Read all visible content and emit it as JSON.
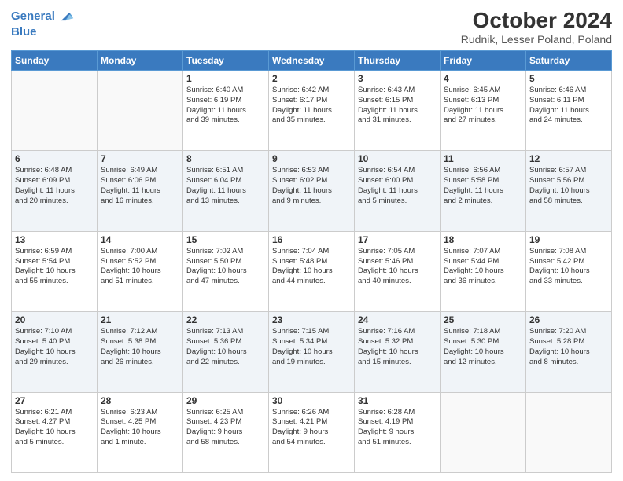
{
  "header": {
    "logo_line1": "General",
    "logo_line2": "Blue",
    "title": "October 2024",
    "subtitle": "Rudnik, Lesser Poland, Poland"
  },
  "weekdays": [
    "Sunday",
    "Monday",
    "Tuesday",
    "Wednesday",
    "Thursday",
    "Friday",
    "Saturday"
  ],
  "weeks": [
    {
      "alt": false,
      "days": [
        {
          "num": "",
          "lines": []
        },
        {
          "num": "",
          "lines": []
        },
        {
          "num": "1",
          "lines": [
            "Sunrise: 6:40 AM",
            "Sunset: 6:19 PM",
            "Daylight: 11 hours",
            "and 39 minutes."
          ]
        },
        {
          "num": "2",
          "lines": [
            "Sunrise: 6:42 AM",
            "Sunset: 6:17 PM",
            "Daylight: 11 hours",
            "and 35 minutes."
          ]
        },
        {
          "num": "3",
          "lines": [
            "Sunrise: 6:43 AM",
            "Sunset: 6:15 PM",
            "Daylight: 11 hours",
            "and 31 minutes."
          ]
        },
        {
          "num": "4",
          "lines": [
            "Sunrise: 6:45 AM",
            "Sunset: 6:13 PM",
            "Daylight: 11 hours",
            "and 27 minutes."
          ]
        },
        {
          "num": "5",
          "lines": [
            "Sunrise: 6:46 AM",
            "Sunset: 6:11 PM",
            "Daylight: 11 hours",
            "and 24 minutes."
          ]
        }
      ]
    },
    {
      "alt": true,
      "days": [
        {
          "num": "6",
          "lines": [
            "Sunrise: 6:48 AM",
            "Sunset: 6:09 PM",
            "Daylight: 11 hours",
            "and 20 minutes."
          ]
        },
        {
          "num": "7",
          "lines": [
            "Sunrise: 6:49 AM",
            "Sunset: 6:06 PM",
            "Daylight: 11 hours",
            "and 16 minutes."
          ]
        },
        {
          "num": "8",
          "lines": [
            "Sunrise: 6:51 AM",
            "Sunset: 6:04 PM",
            "Daylight: 11 hours",
            "and 13 minutes."
          ]
        },
        {
          "num": "9",
          "lines": [
            "Sunrise: 6:53 AM",
            "Sunset: 6:02 PM",
            "Daylight: 11 hours",
            "and 9 minutes."
          ]
        },
        {
          "num": "10",
          "lines": [
            "Sunrise: 6:54 AM",
            "Sunset: 6:00 PM",
            "Daylight: 11 hours",
            "and 5 minutes."
          ]
        },
        {
          "num": "11",
          "lines": [
            "Sunrise: 6:56 AM",
            "Sunset: 5:58 PM",
            "Daylight: 11 hours",
            "and 2 minutes."
          ]
        },
        {
          "num": "12",
          "lines": [
            "Sunrise: 6:57 AM",
            "Sunset: 5:56 PM",
            "Daylight: 10 hours",
            "and 58 minutes."
          ]
        }
      ]
    },
    {
      "alt": false,
      "days": [
        {
          "num": "13",
          "lines": [
            "Sunrise: 6:59 AM",
            "Sunset: 5:54 PM",
            "Daylight: 10 hours",
            "and 55 minutes."
          ]
        },
        {
          "num": "14",
          "lines": [
            "Sunrise: 7:00 AM",
            "Sunset: 5:52 PM",
            "Daylight: 10 hours",
            "and 51 minutes."
          ]
        },
        {
          "num": "15",
          "lines": [
            "Sunrise: 7:02 AM",
            "Sunset: 5:50 PM",
            "Daylight: 10 hours",
            "and 47 minutes."
          ]
        },
        {
          "num": "16",
          "lines": [
            "Sunrise: 7:04 AM",
            "Sunset: 5:48 PM",
            "Daylight: 10 hours",
            "and 44 minutes."
          ]
        },
        {
          "num": "17",
          "lines": [
            "Sunrise: 7:05 AM",
            "Sunset: 5:46 PM",
            "Daylight: 10 hours",
            "and 40 minutes."
          ]
        },
        {
          "num": "18",
          "lines": [
            "Sunrise: 7:07 AM",
            "Sunset: 5:44 PM",
            "Daylight: 10 hours",
            "and 36 minutes."
          ]
        },
        {
          "num": "19",
          "lines": [
            "Sunrise: 7:08 AM",
            "Sunset: 5:42 PM",
            "Daylight: 10 hours",
            "and 33 minutes."
          ]
        }
      ]
    },
    {
      "alt": true,
      "days": [
        {
          "num": "20",
          "lines": [
            "Sunrise: 7:10 AM",
            "Sunset: 5:40 PM",
            "Daylight: 10 hours",
            "and 29 minutes."
          ]
        },
        {
          "num": "21",
          "lines": [
            "Sunrise: 7:12 AM",
            "Sunset: 5:38 PM",
            "Daylight: 10 hours",
            "and 26 minutes."
          ]
        },
        {
          "num": "22",
          "lines": [
            "Sunrise: 7:13 AM",
            "Sunset: 5:36 PM",
            "Daylight: 10 hours",
            "and 22 minutes."
          ]
        },
        {
          "num": "23",
          "lines": [
            "Sunrise: 7:15 AM",
            "Sunset: 5:34 PM",
            "Daylight: 10 hours",
            "and 19 minutes."
          ]
        },
        {
          "num": "24",
          "lines": [
            "Sunrise: 7:16 AM",
            "Sunset: 5:32 PM",
            "Daylight: 10 hours",
            "and 15 minutes."
          ]
        },
        {
          "num": "25",
          "lines": [
            "Sunrise: 7:18 AM",
            "Sunset: 5:30 PM",
            "Daylight: 10 hours",
            "and 12 minutes."
          ]
        },
        {
          "num": "26",
          "lines": [
            "Sunrise: 7:20 AM",
            "Sunset: 5:28 PM",
            "Daylight: 10 hours",
            "and 8 minutes."
          ]
        }
      ]
    },
    {
      "alt": false,
      "days": [
        {
          "num": "27",
          "lines": [
            "Sunrise: 6:21 AM",
            "Sunset: 4:27 PM",
            "Daylight: 10 hours",
            "and 5 minutes."
          ]
        },
        {
          "num": "28",
          "lines": [
            "Sunrise: 6:23 AM",
            "Sunset: 4:25 PM",
            "Daylight: 10 hours",
            "and 1 minute."
          ]
        },
        {
          "num": "29",
          "lines": [
            "Sunrise: 6:25 AM",
            "Sunset: 4:23 PM",
            "Daylight: 9 hours",
            "and 58 minutes."
          ]
        },
        {
          "num": "30",
          "lines": [
            "Sunrise: 6:26 AM",
            "Sunset: 4:21 PM",
            "Daylight: 9 hours",
            "and 54 minutes."
          ]
        },
        {
          "num": "31",
          "lines": [
            "Sunrise: 6:28 AM",
            "Sunset: 4:19 PM",
            "Daylight: 9 hours",
            "and 51 minutes."
          ]
        },
        {
          "num": "",
          "lines": []
        },
        {
          "num": "",
          "lines": []
        }
      ]
    }
  ]
}
